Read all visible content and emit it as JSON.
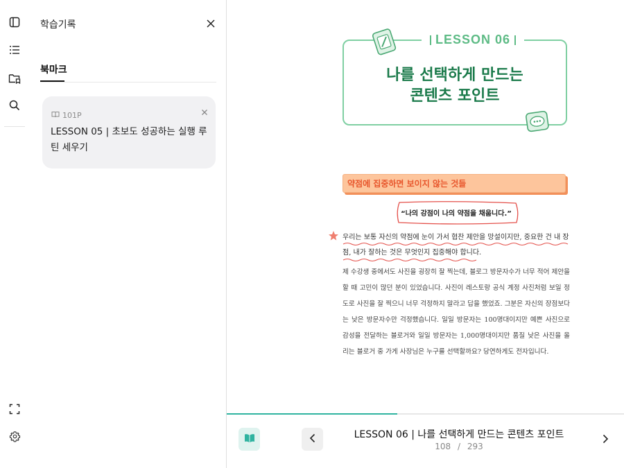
{
  "rail": {
    "icons": [
      "sidebar-toggle-icon",
      "list-icon",
      "folder-bookmark-icon",
      "search-icon",
      "fullscreen-icon",
      "settings-icon"
    ]
  },
  "panel": {
    "title": "학습기록",
    "tab": "북마크",
    "bookmarks": [
      {
        "page": "101P",
        "title": "LESSON 05 | 초보도 성공하는 실행 루틴 세우기"
      }
    ]
  },
  "book": {
    "lesson_label": "LESSON 06",
    "lesson_title_line1": "나를 선택하게 만드는",
    "lesson_title_line2": "콘텐츠 포인트",
    "section_heading": "약점에 집중하면 보이지 않는 것들",
    "quote": "“나의 강점이 나의 약점을 채웁니다.”",
    "highlight_text": "우리는 보통 자신의 약점에 눈이 가서 협찬 제안을 망설이지만, 중요한 건 내 장점, 내가 잘하는 것은 무엇인지 집중해야 합니다.",
    "body_text": "제 수강생 중에서도 사진을 굉장히 잘 찍는데, 블로그 방문자수가 너무 적어 제안을 할 때 고민이 많던 분이 있었습니다. 사진이 레스토랑 공식 계정 사진처럼 보일 정도로 사진을 잘 찍으니 너무 걱정하지 말라고 답을 했었죠. 그분은 자신의 장점보다는 낮은 방문자수만 걱정했습니다. 일일 방문자는 100명대이지만 예쁜 사진으로 감성을 전달하는 블로거와 일일 방문자는 1,000명대이지만 품질 낮은 사진을 올리는 블로거 중 가게 사장님은 누구를 선택할까요? 당연하게도 전자입니다."
  },
  "footer": {
    "chapter": "LESSON 06 | 나를 선택하게 만드는 콘텐츠 포인트",
    "current_page": "108",
    "separator": "/",
    "total_pages": "293",
    "progress": 0.43
  },
  "colors": {
    "accent": "#2fb3a0",
    "lesson_green": "#1a7a4a",
    "orange": "#e8562c"
  }
}
